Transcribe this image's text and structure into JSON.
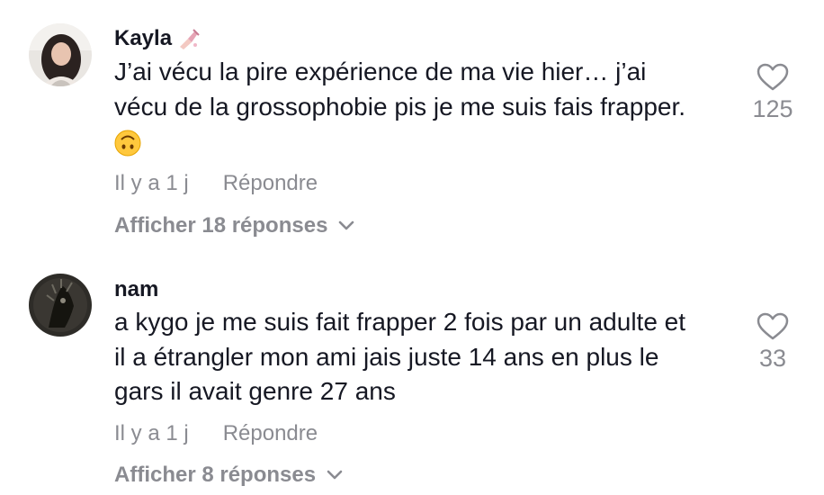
{
  "comments": [
    {
      "author": "Kayla",
      "author_icon": "nail-polish-icon",
      "text_lines": [
        "J’ai vécu la pire expérience de ma vie hier… j’ai",
        "vécu de la grossophobie pis je me suis fais frapper."
      ],
      "emoji": "upside-down-face-emoji",
      "time": "Il y a 1 j",
      "reply_label": "Répondre",
      "view_replies": "Afficher 18 réponses",
      "likes": "125"
    },
    {
      "author": "nam",
      "text_lines": [
        "a kygo je me suis fait frapper 2 fois par un adulte et",
        "il a étrangler mon ami jais juste 14 ans en plus le",
        "gars il avait genre 27 ans"
      ],
      "time": "Il y a 1 j",
      "reply_label": "Répondre",
      "view_replies": "Afficher 8 réponses",
      "likes": "33"
    }
  ],
  "colors": {
    "text": "#161823",
    "secondary": "#8a8b91",
    "background": "#ffffff"
  }
}
